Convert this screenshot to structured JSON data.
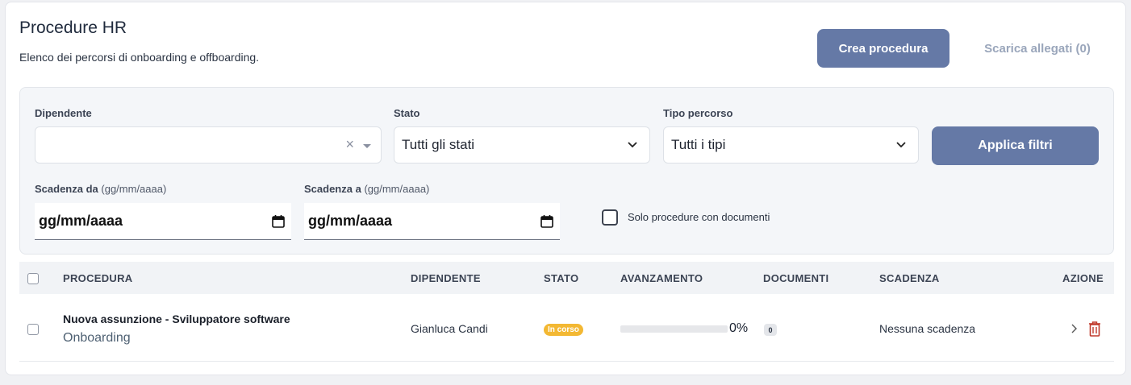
{
  "header": {
    "title": "Procedure HR",
    "subtitle": "Elenco dei percorsi di onboarding e offboarding.",
    "create_label": "Crea procedura",
    "download_label": "Scarica allegati (0)"
  },
  "filters": {
    "employee_label": "Dipendente",
    "employee_value": "",
    "status_label": "Stato",
    "status_value": "Tutti gli stati",
    "type_label": "Tipo percorso",
    "type_value": "Tutti i tipi",
    "apply_label": "Applica filtri",
    "due_from_label": "Scadenza da",
    "due_to_label": "Scadenza a",
    "date_hint": "(gg/mm/aaaa)",
    "due_from_value": "gg/mm/aaaa",
    "due_to_value": "gg/mm/aaaa",
    "docs_only_label": "Solo procedure con documenti",
    "docs_only_checked": false
  },
  "table": {
    "columns": {
      "procedure": "PROCEDURA",
      "employee": "DIPENDENTE",
      "status": "STATO",
      "progress": "AVANZAMENTO",
      "documents": "DOCUMENTI",
      "due": "SCADENZA",
      "action": "AZIONE"
    },
    "rows": [
      {
        "name": "Nuova assunzione - Sviluppatore software",
        "type": "Onboarding",
        "employee": "Gianluca Candi",
        "status": "In corso",
        "progress_percent": 0,
        "progress_label": "0%",
        "documents": "0",
        "due": "Nessuna scadenza"
      }
    ]
  },
  "colors": {
    "accent": "#6579a6",
    "status_in_progress": "#f3b833",
    "delete": "#c0392b"
  },
  "icons": [
    "clear-icon",
    "caret-down-icon",
    "chevron-down-icon",
    "calendar-icon",
    "chevron-right-icon",
    "trash-icon"
  ]
}
